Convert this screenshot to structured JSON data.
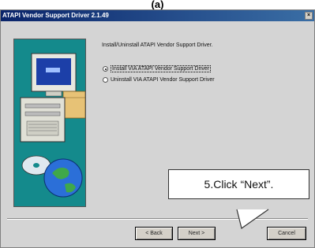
{
  "figure_label": "(a)",
  "window": {
    "title": "ATAPI Vendor Support Driver 2.1.49",
    "close_glyph": "×"
  },
  "content": {
    "instruction": "Install/Uninstall ATAPI Vendor Support Driver.",
    "options": [
      {
        "label": "Install VIA ATAPI Vendor Support Driver",
        "selected": true
      },
      {
        "label": "Uninstall VIA ATAPI Vendor Support Driver",
        "selected": false
      }
    ]
  },
  "buttons": {
    "back": "< Back",
    "next": "Next >",
    "cancel": "Cancel"
  },
  "callout": {
    "text": "5.Click “Next”."
  }
}
